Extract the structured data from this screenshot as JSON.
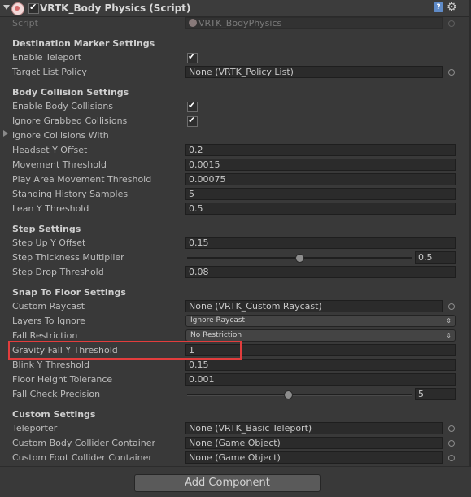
{
  "header": {
    "title": "VRTK_Body Physics (Script)"
  },
  "script": {
    "label": "Script",
    "value": "VRTK_BodyPhysics"
  },
  "destination": {
    "title": "Destination Marker Settings",
    "enable_teleport": "Enable Teleport",
    "target_list_policy": "Target List Policy",
    "target_list_policy_value": "None (VRTK_Policy List)"
  },
  "body_collision": {
    "title": "Body Collision Settings",
    "enable_body_collisions": "Enable Body Collisions",
    "ignore_grabbed": "Ignore Grabbed Collisions",
    "ignore_with": "Ignore Collisions With",
    "headset_y_offset": "Headset Y Offset",
    "headset_y_offset_value": "0.2",
    "movement_threshold": "Movement Threshold",
    "movement_threshold_value": "0.0015",
    "play_area_threshold": "Play Area Movement Threshold",
    "play_area_threshold_value": "0.00075",
    "standing_history": "Standing History Samples",
    "standing_history_value": "5",
    "lean_y": "Lean Y Threshold",
    "lean_y_value": "0.5"
  },
  "step": {
    "title": "Step Settings",
    "step_up": "Step Up Y Offset",
    "step_up_value": "0.15",
    "thickness": "Step Thickness Multiplier",
    "thickness_value": "0.5",
    "thickness_level": 0.5,
    "drop": "Step Drop Threshold",
    "drop_value": "0.08"
  },
  "snap": {
    "title": "Snap To Floor Settings",
    "custom_raycast": "Custom Raycast",
    "custom_raycast_value": "None (VRTK_Custom Raycast)",
    "layers_ignore": "Layers To Ignore",
    "layers_ignore_value": "Ignore Raycast",
    "fall_restriction": "Fall Restriction",
    "fall_restriction_value": "No Restriction",
    "gravity_fall": "Gravity Fall Y Threshold",
    "gravity_fall_value": "1",
    "blink_y": "Blink Y Threshold",
    "blink_y_value": "0.15",
    "floor_height": "Floor Height Tolerance",
    "floor_height_value": "0.001",
    "fall_check": "Fall Check Precision",
    "fall_check_value": "5",
    "fall_check_level": 0.45
  },
  "custom": {
    "title": "Custom Settings",
    "teleporter": "Teleporter",
    "teleporter_value": "None (VRTK_Basic Teleport)",
    "body_container": "Custom Body Collider Container",
    "body_container_value": "None (Game Object)",
    "foot_container": "Custom Foot Collider Container",
    "foot_container_value": "None (Game Object)"
  },
  "footer": {
    "add_component": "Add Component"
  },
  "colors": {
    "highlight": "#e23d3d",
    "background": "#393939"
  }
}
